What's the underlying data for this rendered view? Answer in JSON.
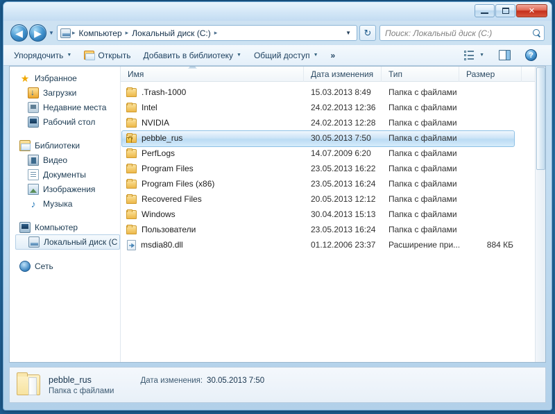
{
  "window": {
    "title": "",
    "buttons": {
      "minimize": "–",
      "maximize": "□",
      "close": "✕"
    }
  },
  "navbar": {
    "back_icon": "◀",
    "forward_icon": "▶",
    "history_caret": "▼",
    "breadcrumb_sep": "▸",
    "breadcrumbs": [
      "Компьютер",
      "Локальный диск (C:)"
    ],
    "address_caret": "▼",
    "refresh_icon": "↻",
    "search_placeholder": "Поиск: Локальный диск (C:)",
    "search_value": ""
  },
  "commandbar": {
    "organize": "Упорядочить",
    "open": "Открыть",
    "add_to_library": "Добавить в библиотеку",
    "share": "Общий доступ",
    "overflow": "»",
    "caret": "▼",
    "help_label": "?"
  },
  "sidebar": {
    "groups": [
      {
        "header": "Избранное",
        "header_icon": "star-icon",
        "items": [
          {
            "label": "Загрузки",
            "icon": "downloads-icon"
          },
          {
            "label": "Недавние места",
            "icon": "recent-places-icon"
          },
          {
            "label": "Рабочий стол",
            "icon": "desktop-icon"
          }
        ]
      },
      {
        "header": "Библиотеки",
        "header_icon": "library-icon",
        "items": [
          {
            "label": "Видео",
            "icon": "video-icon"
          },
          {
            "label": "Документы",
            "icon": "documents-icon"
          },
          {
            "label": "Изображения",
            "icon": "pictures-icon"
          },
          {
            "label": "Музыка",
            "icon": "music-icon"
          }
        ]
      },
      {
        "header": "Компьютер",
        "header_icon": "computer-icon",
        "items": [
          {
            "label": "Локальный диск (C",
            "icon": "drive-icon",
            "selected": true
          }
        ]
      },
      {
        "header": "Сеть",
        "header_icon": "network-icon",
        "items": []
      }
    ]
  },
  "filelist": {
    "columns": [
      {
        "label": "Имя",
        "key": "name"
      },
      {
        "label": "Дата изменения",
        "key": "date"
      },
      {
        "label": "Тип",
        "key": "type"
      },
      {
        "label": "Размер",
        "key": "size"
      }
    ],
    "sort_column": "name",
    "sort_direction": "ascending",
    "rows": [
      {
        "name": ".Trash-1000",
        "date": "15.03.2013 8:49",
        "type": "Папка с файлами",
        "size": "",
        "icon": "folder-icon",
        "selected": false
      },
      {
        "name": "Intel",
        "date": "24.02.2013 12:36",
        "type": "Папка с файлами",
        "size": "",
        "icon": "folder-icon",
        "selected": false
      },
      {
        "name": "NVIDIA",
        "date": "24.02.2013 12:28",
        "type": "Папка с файлами",
        "size": "",
        "icon": "folder-icon",
        "selected": false
      },
      {
        "name": "pebble_rus",
        "date": "30.05.2013 7:50",
        "type": "Папка с файлами",
        "size": "",
        "icon": "folder-locked-icon",
        "selected": true
      },
      {
        "name": "PerfLogs",
        "date": "14.07.2009 6:20",
        "type": "Папка с файлами",
        "size": "",
        "icon": "folder-icon",
        "selected": false
      },
      {
        "name": "Program Files",
        "date": "23.05.2013 16:22",
        "type": "Папка с файлами",
        "size": "",
        "icon": "folder-icon",
        "selected": false
      },
      {
        "name": "Program Files (x86)",
        "date": "23.05.2013 16:24",
        "type": "Папка с файлами",
        "size": "",
        "icon": "folder-icon",
        "selected": false
      },
      {
        "name": "Recovered Files",
        "date": "20.05.2013 12:12",
        "type": "Папка с файлами",
        "size": "",
        "icon": "folder-icon",
        "selected": false
      },
      {
        "name": "Windows",
        "date": "30.04.2013 15:13",
        "type": "Папка с файлами",
        "size": "",
        "icon": "folder-icon",
        "selected": false
      },
      {
        "name": "Пользователи",
        "date": "23.05.2013 16:24",
        "type": "Папка с файлами",
        "size": "",
        "icon": "folder-icon",
        "selected": false
      },
      {
        "name": "msdia80.dll",
        "date": "01.12.2006 23:37",
        "type": "Расширение при...",
        "size": "884 КБ",
        "icon": "dll-file-icon",
        "selected": false
      }
    ]
  },
  "details": {
    "name": "pebble_rus",
    "kind": "Папка с файлами",
    "date_label": "Дата изменения:",
    "date_value": "30.05.2013 7:50"
  },
  "colors": {
    "selection": "#bbdbf4",
    "accent": "#1d5a8c",
    "folder": "#edb84b"
  }
}
